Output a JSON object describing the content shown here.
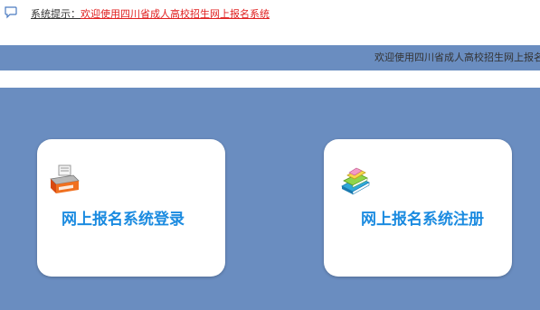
{
  "notice": {
    "icon": "speech-bubble-icon",
    "label": "系统提示：",
    "message": "欢迎使用四川省成人高校招生网上报名系统"
  },
  "marquee": {
    "text": "欢迎使用四川省成人高校招生网上报名"
  },
  "cards": {
    "login": {
      "icon": "printer-icon",
      "label": "网上报名系统登录"
    },
    "register": {
      "icon": "books-icon",
      "label": "网上报名系统注册"
    }
  },
  "colors": {
    "panel_blue": "#6a8dc0",
    "card_text_blue": "#1b8be0",
    "notice_red": "#e02020"
  }
}
